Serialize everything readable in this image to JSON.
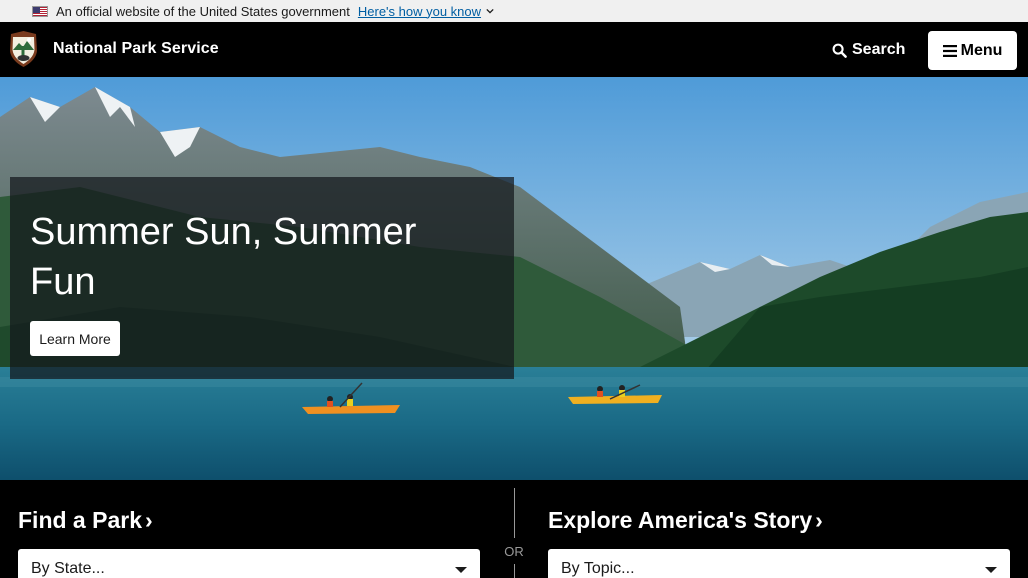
{
  "gov_banner": {
    "text": "An official website of the United States government",
    "link": "Here's how you know"
  },
  "header": {
    "site_name": "National Park Service",
    "search_label": "Search",
    "menu_label": "Menu"
  },
  "hero": {
    "title": "Summer Sun, Summer Fun",
    "button_label": "Learn More"
  },
  "find": {
    "park_title": "Find a Park",
    "park_select": "By State...",
    "or_text": "OR",
    "story_title": "Explore America's Story",
    "story_select": "By Topic..."
  },
  "colors": {
    "link": "#005ea2",
    "header_bg": "#000000",
    "banner_bg": "#f0f0f0"
  }
}
